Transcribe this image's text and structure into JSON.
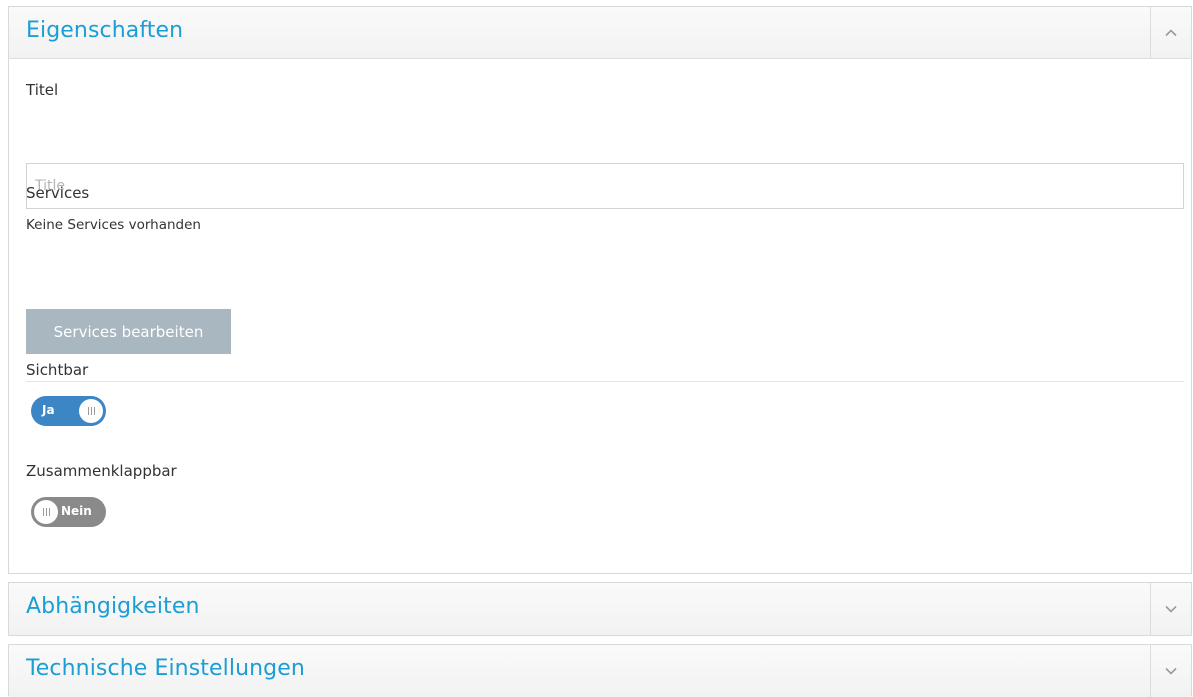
{
  "properties_panel": {
    "title": "Eigenschaften",
    "toggle_icon": "chevron-up-icon",
    "title_field": {
      "label": "Titel",
      "value": "",
      "placeholder": "Title"
    },
    "services": {
      "label": "Services",
      "empty_text": "Keine Services vorhanden",
      "edit_button_label": "Services bearbeiten"
    },
    "visible_switch": {
      "label": "Sichtbar",
      "state_text": "Ja",
      "checked": true
    },
    "collapsible_switch": {
      "label": "Zusammenklappbar",
      "state_text": "Nein",
      "checked": false
    }
  },
  "dependencies_panel": {
    "title": "Abhängigkeiten",
    "toggle_icon": "chevron-down-icon"
  },
  "technical_panel": {
    "title": "Technische Einstellungen",
    "toggle_icon": "chevron-down-icon"
  },
  "colors": {
    "accent_title": "#1b9ed4",
    "switch_on": "#3c86c6",
    "switch_off": "#8a8a8a",
    "button_disabled": "#a8b7c0"
  }
}
